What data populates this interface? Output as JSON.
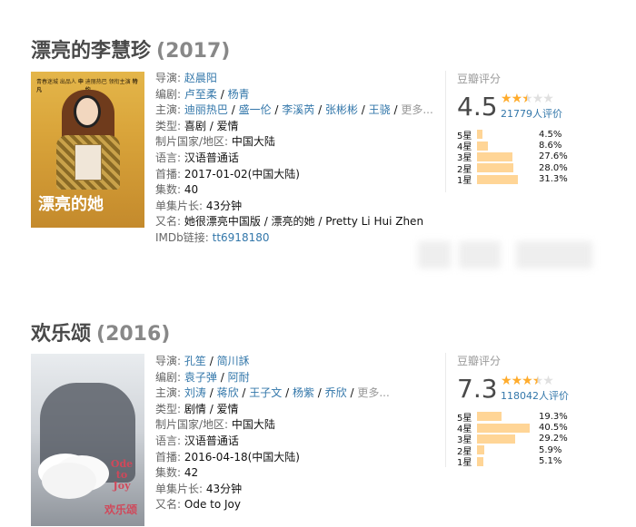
{
  "entries": [
    {
      "title": "漂亮的李慧珍",
      "year": "(2017)",
      "poster": {
        "credit_left": "青春迷城 出品人",
        "credit_left_name": "申凡",
        "credit_right": "迪丽热巴 领衔主演",
        "credit_right_name": "特约",
        "title_text": "漂亮的她",
        "colors": {
          "bg": "#e4b64a"
        }
      },
      "info": {
        "director_label": "导演:",
        "directors": [
          "赵晨阳"
        ],
        "writer_label": "编剧:",
        "writers": [
          "卢至柔",
          "杨青"
        ],
        "cast_label": "主演:",
        "cast": [
          "迪丽热巴",
          "盛一伦",
          "李溪芮",
          "张彬彬",
          "王骁"
        ],
        "more": "更多...",
        "genre_label": "类型:",
        "genre": "喜剧 / 爱情",
        "country_label": "制片国家/地区:",
        "country": "中国大陆",
        "language_label": "语言:",
        "language": "汉语普通话",
        "premiere_label": "首播:",
        "premiere": "2017-01-02(中国大陆)",
        "episodes_label": "集数:",
        "episodes": "40",
        "runtime_label": "单集片长:",
        "runtime": "43分钟",
        "aka_label": "又名:",
        "aka": "她很漂亮中国版 / 漂亮的她 / Pretty Li Hui Zhen",
        "imdb_label": "IMDb链接:",
        "imdb": "tt6918180"
      },
      "rating": {
        "title": "豆瓣评分",
        "score": "4.5",
        "stars_filled": 2.5,
        "votes": "21779人评价",
        "breakdown": [
          {
            "label": "5星",
            "pct_text": "4.5%",
            "pct": 4.5
          },
          {
            "label": "4星",
            "pct_text": "8.6%",
            "pct": 8.6
          },
          {
            "label": "3星",
            "pct_text": "27.6%",
            "pct": 27.6
          },
          {
            "label": "2星",
            "pct_text": "28.0%",
            "pct": 28.0
          },
          {
            "label": "1星",
            "pct_text": "31.3%",
            "pct": 31.3
          }
        ]
      }
    },
    {
      "title": "欢乐颂",
      "year": "(2016)",
      "poster": {
        "en_title": "Ode to Joy",
        "zh_title": "欢乐颂",
        "colors": {
          "bg": "#e9ecef",
          "accent": "#d0485a"
        }
      },
      "info": {
        "director_label": "导演:",
        "directors": [
          "孔笙",
          "简川訸"
        ],
        "writer_label": "编剧:",
        "writers": [
          "袁子弹",
          "阿耐"
        ],
        "cast_label": "主演:",
        "cast": [
          "刘涛",
          "蒋欣",
          "王子文",
          "杨紫",
          "乔欣"
        ],
        "more": "更多...",
        "genre_label": "类型:",
        "genre": "剧情 / 爱情",
        "country_label": "制片国家/地区:",
        "country": "中国大陆",
        "language_label": "语言:",
        "language": "汉语普通话",
        "premiere_label": "首播:",
        "premiere": "2016-04-18(中国大陆)",
        "episodes_label": "集数:",
        "episodes": "42",
        "runtime_label": "单集片长:",
        "runtime": "43分钟",
        "aka_label": "又名:",
        "aka": "Ode to Joy"
      },
      "rating": {
        "title": "豆瓣评分",
        "score": "7.3",
        "stars_filled": 3.5,
        "votes": "118042人评价",
        "breakdown": [
          {
            "label": "5星",
            "pct_text": "19.3%",
            "pct": 19.3
          },
          {
            "label": "4星",
            "pct_text": "40.5%",
            "pct": 40.5
          },
          {
            "label": "3星",
            "pct_text": "29.2%",
            "pct": 29.2
          },
          {
            "label": "2星",
            "pct_text": "5.9%",
            "pct": 5.9
          },
          {
            "label": "1星",
            "pct_text": "5.1%",
            "pct": 5.1
          }
        ]
      }
    }
  ],
  "colors": {
    "link": "#3377aa",
    "star": "#ffac2d",
    "bar": "#ffd596",
    "title": "#494949"
  }
}
